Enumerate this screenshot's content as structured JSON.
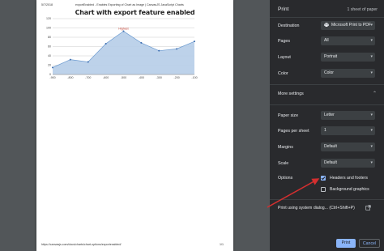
{
  "page": {
    "header_left": "5/7/2018",
    "header_center": "exportEnabled - Enables Exporting of Chart as Image | CanvasJS JavaScript Charts",
    "footer_left": "https://canvasjs.com/docs/charts/chart-options/exportenabled/",
    "footer_right": "1/1"
  },
  "chart_data": {
    "type": "area",
    "title": "Chart with export feature enabled",
    "x": [
      -900,
      -800,
      -700,
      -600,
      -500,
      -400,
      -300,
      -200,
      -100
    ],
    "x_tick_labels": [
      "-900",
      "-800",
      "-700",
      "-600",
      "-500",
      "-400",
      "-300",
      "-200",
      "-100"
    ],
    "values": [
      15,
      32,
      27,
      66,
      93,
      68,
      51,
      55,
      71
    ],
    "ylim": [
      0,
      120
    ],
    "y_ticks": [
      0,
      20,
      40,
      60,
      80,
      100,
      120
    ],
    "y_tick_labels": [
      "0",
      "20",
      "40",
      "60",
      "80",
      "100",
      "120"
    ],
    "annotations": [
      {
        "x": -500,
        "text": "Highest"
      }
    ],
    "grid": true,
    "colors": {
      "fill": "#b6cde8",
      "line": "#6d9bd0",
      "marker": "#3f6fb0",
      "annotation": "#c0392b",
      "grid": "#bfbfbf"
    }
  },
  "print_panel": {
    "title": "Print",
    "sheet_count": "1 sheet of paper",
    "destination_label": "Destination",
    "destination_value": "Microsoft Print to PDF",
    "pages_label": "Pages",
    "pages_value": "All",
    "layout_label": "Layout",
    "layout_value": "Portrait",
    "color_label": "Color",
    "color_value": "Color",
    "more_settings_label": "More settings",
    "paper_size_label": "Paper size",
    "paper_size_value": "Letter",
    "pages_per_sheet_label": "Pages per sheet",
    "pages_per_sheet_value": "1",
    "margins_label": "Margins",
    "margins_value": "Default",
    "scale_label": "Scale",
    "scale_value": "Default",
    "options_label": "Options",
    "option_headers_footers": "Headers and footers",
    "option_headers_footers_checked": true,
    "option_background_graphics": "Background graphics",
    "option_background_graphics_checked": false,
    "system_dialog_label": "Print using system dialog... (Ctrl+Shift+P)",
    "print_button": "Print",
    "cancel_button": "Cancel",
    "colors": {
      "panel_bg": "#292a2d",
      "accent": "#8ab4f8",
      "annotation_arrow": "#d32f2f"
    }
  }
}
